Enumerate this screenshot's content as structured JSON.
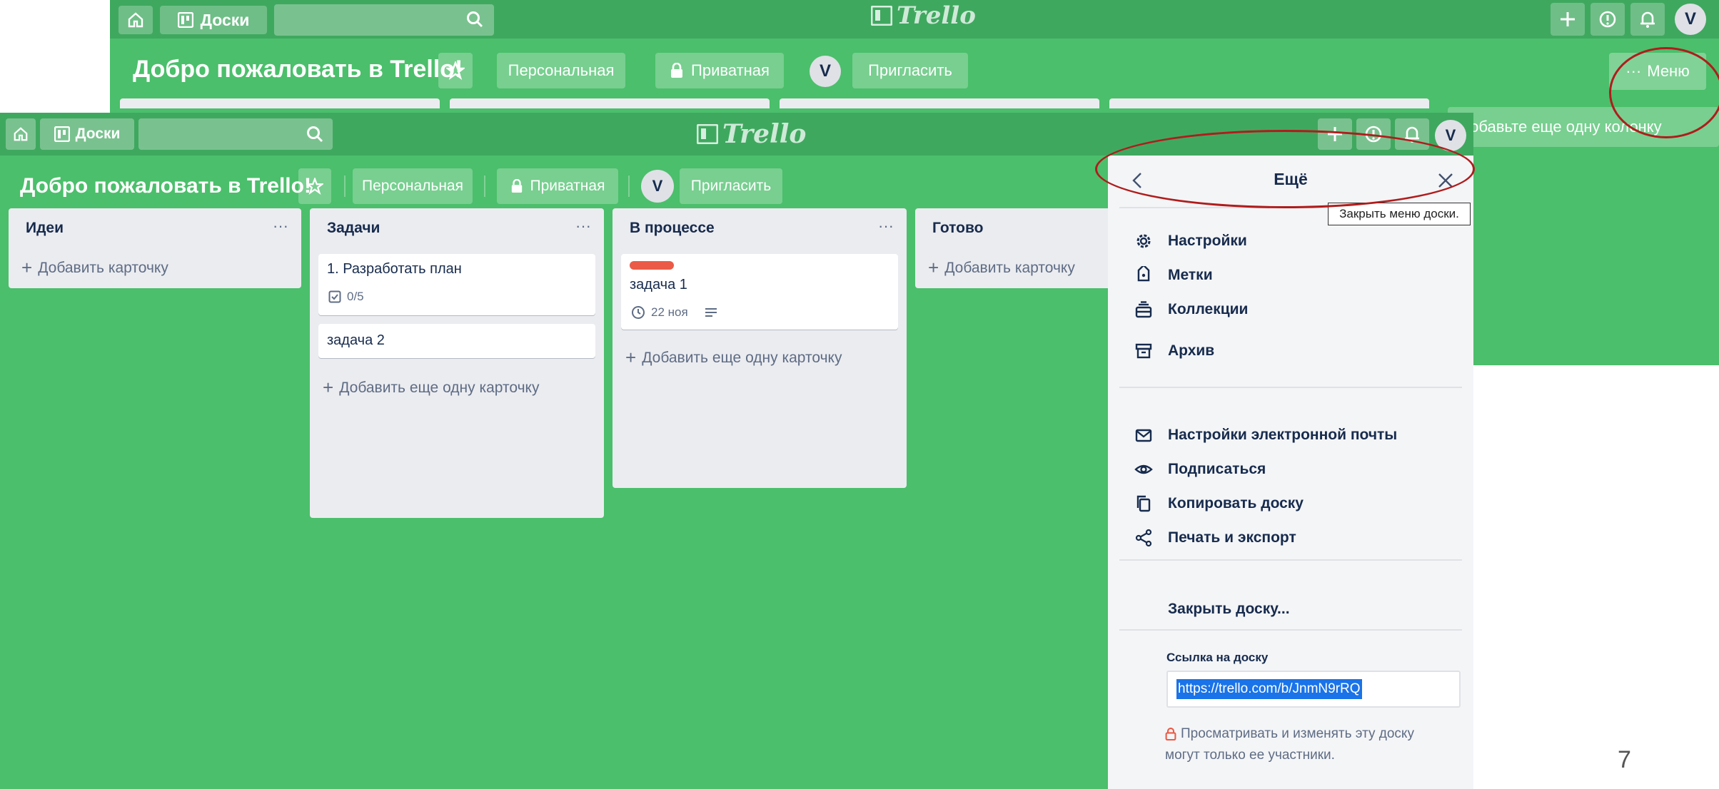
{
  "back": {
    "boards_label": "Доски",
    "logo": "Trello",
    "board_title": "Добро пожаловать в Trello!",
    "personal": "Персональная",
    "private": "Приватная",
    "member_initial": "V",
    "invite": "Пригласить",
    "menu": "Меню",
    "avatar_initial": "V",
    "add_column": "Добавьте еще одну колонку"
  },
  "front": {
    "boards_label": "Доски",
    "logo": "Trello",
    "board_title": "Добро пожаловать в Trello!",
    "personal": "Персональная",
    "private": "Приватная",
    "member_initial": "V",
    "invite": "Пригласить",
    "avatar_initial": "V",
    "lists": [
      {
        "title": "Идеи",
        "add_label": "Добавить карточку"
      },
      {
        "title": "Задачи",
        "cards": [
          {
            "text": "1. Разработать план",
            "checklist": "0/5"
          },
          {
            "text": "задача 2"
          }
        ],
        "add_label": "Добавить еще одну карточку"
      },
      {
        "title": "В процессе",
        "cards": [
          {
            "text": "задача 1",
            "due": "22 ноя",
            "label_color": "#eb5a46"
          }
        ],
        "add_label": "Добавить еще одну карточку"
      },
      {
        "title": "Готово",
        "add_label": "Добавить карточку"
      }
    ]
  },
  "menu": {
    "title": "Ещё",
    "close_tooltip": "Закрыть меню доски.",
    "items_a": [
      "Настройки",
      "Метки",
      "Коллекции",
      "Архив"
    ],
    "items_b": [
      "Настройки электронной почты",
      "Подписаться",
      "Копировать доску",
      "Печать и экспорт"
    ],
    "close_board": "Закрыть доску...",
    "link_label": "Ссылка на доску",
    "link_value": "https://trello.com/b/JnmN9rRQ",
    "privacy_note_1": "Просматривать и изменять эту доску",
    "privacy_note_2": "могут только ее участники."
  },
  "page_number": "7",
  "colors": {
    "board_green": "#4bbf6b",
    "header_green": "#3fa85f",
    "annotation_red": "#b01c1c"
  }
}
